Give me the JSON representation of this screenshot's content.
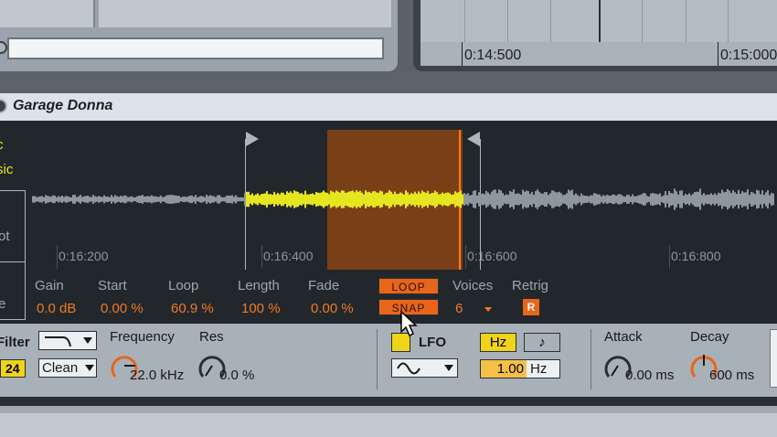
{
  "top": {
    "timeline_ticks": [
      "0:14:500",
      "0:15:000"
    ]
  },
  "clip": {
    "title": "Garage Donna",
    "side_labels": [
      "c",
      "sic",
      "ot",
      "e"
    ],
    "wave_ticks": [
      "0:16:200",
      "0:16:400",
      "0:16:600",
      "0:16:800"
    ]
  },
  "params": {
    "gain": {
      "label": "Gain",
      "value": "0.0 dB"
    },
    "start": {
      "label": "Start",
      "value": "0.00 %"
    },
    "loop": {
      "label": "Loop",
      "value": "60.9 %"
    },
    "length": {
      "label": "Length",
      "value": "100 %"
    },
    "fade": {
      "label": "Fade",
      "value": "0.00 %"
    },
    "loop_button": "LOOP",
    "snap_button": "SNAP",
    "voices": {
      "label": "Voices",
      "value": "6"
    },
    "retrig": {
      "label": "Retrig",
      "button": "R"
    }
  },
  "device": {
    "filter_label": "Filter",
    "filter_slope": "24",
    "filter_circuit": "Clean",
    "frequency": {
      "label": "Frequency",
      "value": "22.0 kHz"
    },
    "res": {
      "label": "Res",
      "value": "0.0 %"
    },
    "lfo_label": "LFO",
    "hz_button": "Hz",
    "note_button": "♪",
    "rate_value": "1.00",
    "rate_unit": "Hz",
    "attack": {
      "label": "Attack",
      "value": "0.00 ms"
    },
    "decay": {
      "label": "Decay",
      "value": "600 ms"
    }
  },
  "colors": {
    "accent_orange": "#e8651a",
    "waveform_active": "#e6e620",
    "waveform_inactive": "#8f979e",
    "lfo_yellow": "#f0d418"
  }
}
